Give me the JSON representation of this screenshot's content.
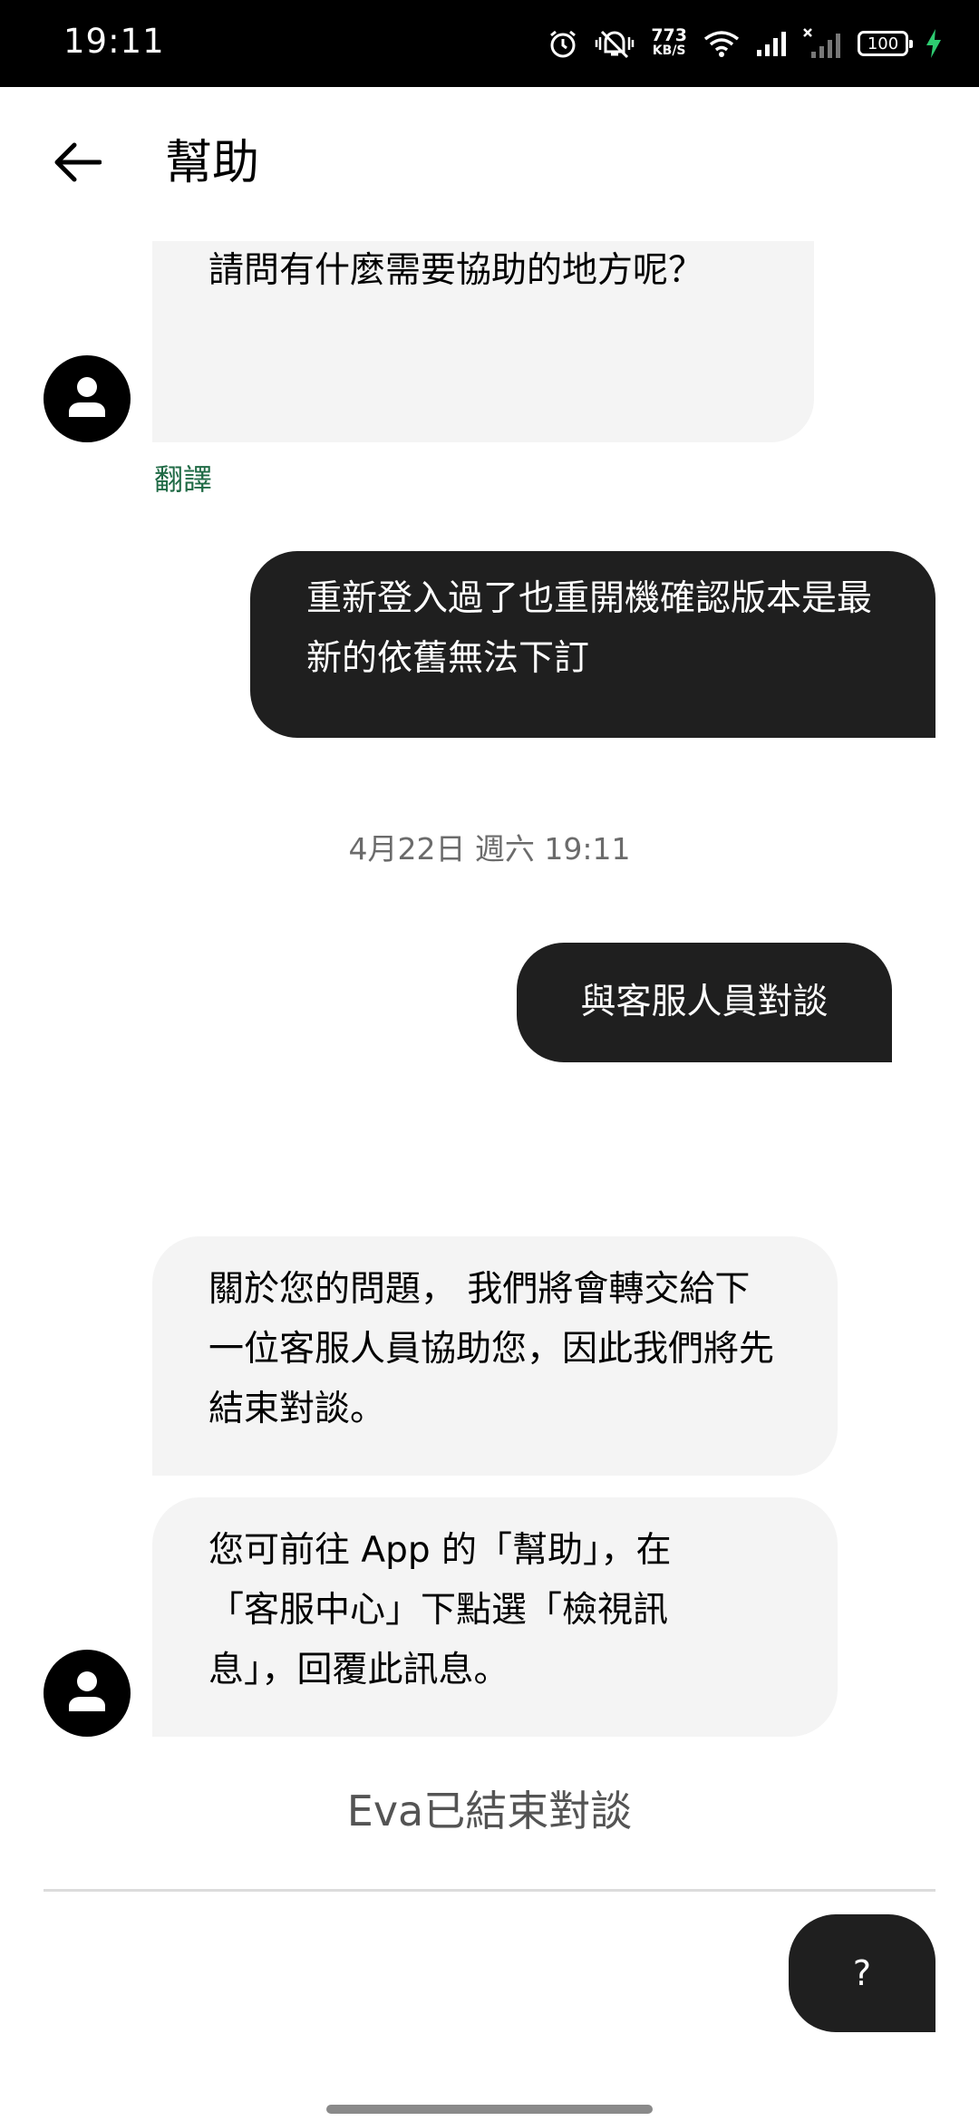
{
  "status_bar": {
    "time": "19:11",
    "net_speed_value": "773",
    "net_speed_unit": "KB/S",
    "battery": "100",
    "icons": [
      "alarm-icon",
      "mute-vibrate-icon",
      "wifi-icon",
      "signal-icon",
      "signal-no-service-icon",
      "battery-icon",
      "charging-icon"
    ]
  },
  "header": {
    "title": "幫助",
    "back_icon": "arrow-left-icon"
  },
  "messages": {
    "bot_question": "請問有什麼需要協助的地方呢？",
    "translate_label": "翻譯",
    "user_message_1": "重新登入過了也重開機確認版本是最新的依舊無法下訂",
    "timestamp": "4月22日 週六 19:11",
    "user_message_2": "與客服人員對談",
    "bot_transfer": "關於您的問題， 我們將會轉交給下一位客服人員協助您，因此我們將先結束對談。",
    "bot_instructions": "您可前往 App 的「幫助」，在「客服中心」下點選「檢視訊息」，回覆此訊息。"
  },
  "footer": {
    "end_notice": "Eva已結束對談",
    "quick_reply_label": "?"
  },
  "colors": {
    "bot_bubble": "#f4f4f4",
    "user_bubble": "#1f1f1f",
    "translate_link": "#1f6a45"
  }
}
